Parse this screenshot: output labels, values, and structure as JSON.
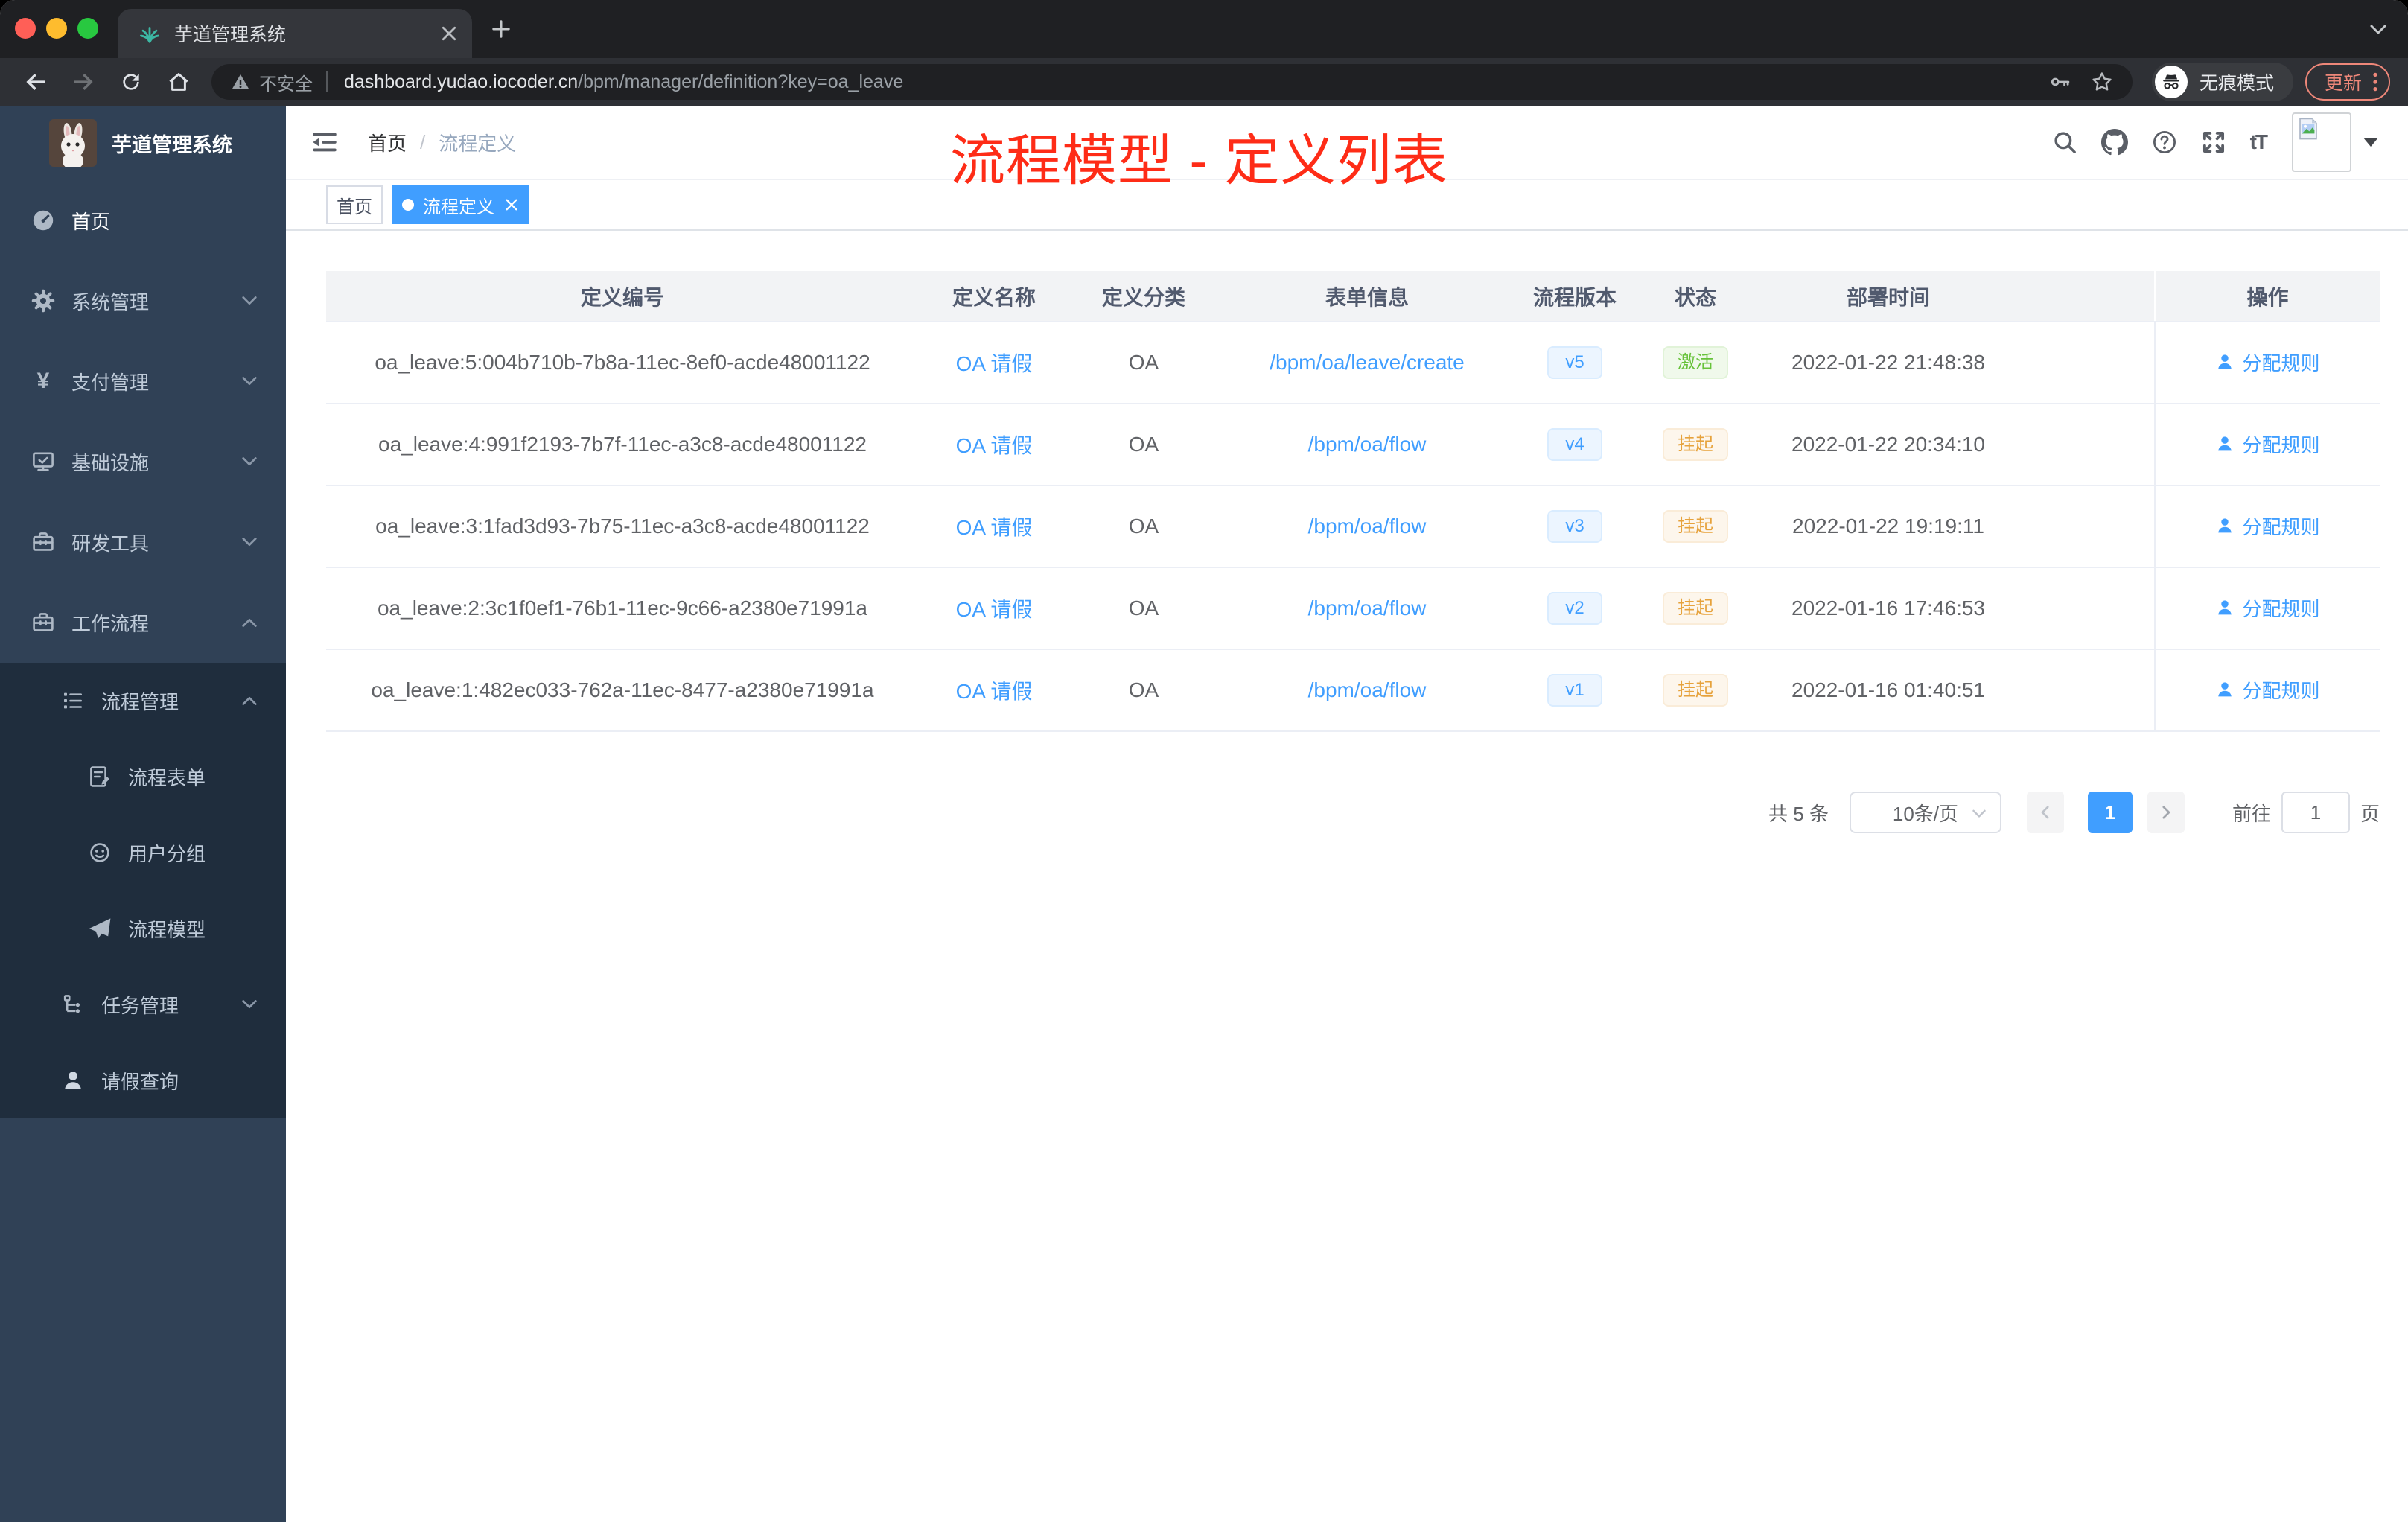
{
  "browser": {
    "tab": {
      "title": "芋道管理系统"
    },
    "traffic_lights": [
      "#ff5f57",
      "#febc2e",
      "#28c840"
    ],
    "url": {
      "security": "不安全",
      "host": "dashboard.yudao.iocoder.cn",
      "path": "/bpm/manager/definition?key=oa_leave"
    },
    "incognito_label": "无痕模式",
    "update_label": "更新"
  },
  "sidebar": {
    "title": "芋道管理系统",
    "items": [
      {
        "key": "home",
        "label": "首页",
        "icon": "dashboard-icon",
        "level": 1,
        "bright": true
      },
      {
        "key": "system",
        "label": "系统管理",
        "icon": "gear-icon",
        "level": 1,
        "chevron": "down"
      },
      {
        "key": "payment",
        "label": "支付管理",
        "icon": "yen-icon",
        "level": 1,
        "chevron": "down"
      },
      {
        "key": "infrastructure",
        "label": "基础设施",
        "icon": "monitor-icon",
        "level": 1,
        "chevron": "down"
      },
      {
        "key": "dev-tools",
        "label": "研发工具",
        "icon": "toolbox-icon",
        "level": 1,
        "chevron": "down"
      },
      {
        "key": "workflow",
        "label": "工作流程",
        "icon": "briefcase-icon",
        "level": 1,
        "chevron": "up"
      },
      {
        "key": "process-mgmt",
        "label": "流程管理",
        "icon": "list-icon",
        "level": 2,
        "chevron": "up",
        "submenu": true
      },
      {
        "key": "process-form",
        "label": "流程表单",
        "icon": "form-icon",
        "level": 3,
        "submenu": true
      },
      {
        "key": "user-group",
        "label": "用户分组",
        "icon": "robot-icon",
        "level": 3,
        "submenu": true
      },
      {
        "key": "process-model",
        "label": "流程模型",
        "icon": "send-icon",
        "level": 3,
        "submenu": true
      },
      {
        "key": "task-mgmt",
        "label": "任务管理",
        "icon": "tree-icon",
        "level": 2,
        "chevron": "down",
        "submenu": true
      },
      {
        "key": "leave-query",
        "label": "请假查询",
        "icon": "user-icon",
        "level": 2,
        "submenu": true,
        "iconlight": true
      }
    ]
  },
  "navbar": {
    "breadcrumb": {
      "home": "首页",
      "separator": "/",
      "current": "流程定义"
    },
    "annotation": "流程模型 - 定义列表"
  },
  "tags": {
    "home": "首页",
    "current": "流程定义"
  },
  "table": {
    "columns": [
      "定义编号",
      "定义名称",
      "定义分类",
      "表单信息",
      "流程版本",
      "状态",
      "部署时间",
      "操作"
    ],
    "action_label": "分配规则",
    "rows": [
      {
        "id": "oa_leave:5:004b710b-7b8a-11ec-8ef0-acde48001122",
        "name": "OA 请假",
        "category": "OA",
        "form": "/bpm/oa/leave/create",
        "version": "v5",
        "status": "激活",
        "status_type": "success",
        "time": "2022-01-22 21:48:38"
      },
      {
        "id": "oa_leave:4:991f2193-7b7f-11ec-a3c8-acde48001122",
        "name": "OA 请假",
        "category": "OA",
        "form": "/bpm/oa/flow",
        "version": "v4",
        "status": "挂起",
        "status_type": "warning",
        "time": "2022-01-22 20:34:10"
      },
      {
        "id": "oa_leave:3:1fad3d93-7b75-11ec-a3c8-acde48001122",
        "name": "OA 请假",
        "category": "OA",
        "form": "/bpm/oa/flow",
        "version": "v3",
        "status": "挂起",
        "status_type": "warning",
        "time": "2022-01-22 19:19:11"
      },
      {
        "id": "oa_leave:2:3c1f0ef1-76b1-11ec-9c66-a2380e71991a",
        "name": "OA 请假",
        "category": "OA",
        "form": "/bpm/oa/flow",
        "version": "v2",
        "status": "挂起",
        "status_type": "warning",
        "time": "2022-01-16 17:46:53"
      },
      {
        "id": "oa_leave:1:482ec033-762a-11ec-8477-a2380e71991a",
        "name": "OA 请假",
        "category": "OA",
        "form": "/bpm/oa/flow",
        "version": "v1",
        "status": "挂起",
        "status_type": "warning",
        "time": "2022-01-16 01:40:51"
      }
    ]
  },
  "pagination": {
    "total": "共 5 条",
    "page_size": "10条/页",
    "page": "1",
    "goto": "前往",
    "unit": "页"
  },
  "colors": {
    "accent": "#409eff",
    "success": "#67c23a",
    "warning": "#e6a23c",
    "annotation_red": "#fe2c17",
    "sidebar_bg": "#304156",
    "submenu_bg": "#1f2d3d"
  }
}
